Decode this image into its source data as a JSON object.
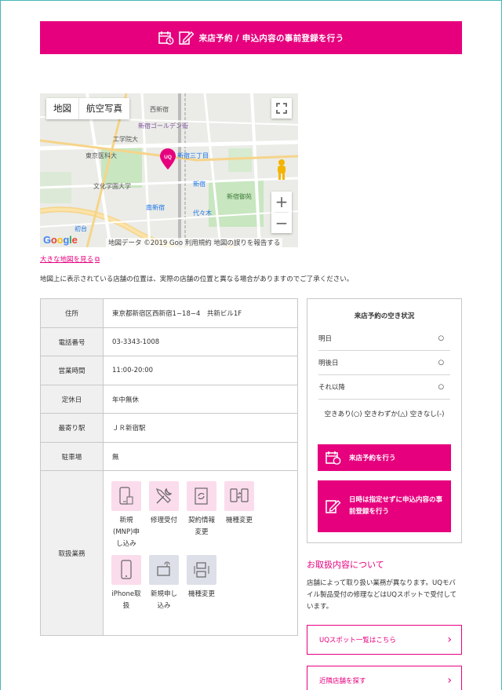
{
  "colors": {
    "accent": "#e6007e",
    "frame": "#48b6b9"
  },
  "top_button": {
    "label": "来店予約 / 申込内容の事前登録を行う",
    "icons": [
      "calendar-clock-icon",
      "pencil-note-icon"
    ]
  },
  "map": {
    "tabs": [
      "地図",
      "航空写真"
    ],
    "labels": {
      "west_shinjuku": "西新宿",
      "golden_gai": "新宿ゴールデン街",
      "kogakuin": "工学院大",
      "tokyo_medical": "東京医科大",
      "shinjuku_3": "新宿三丁目",
      "shinjuku_station": "新宿",
      "bunka": "文化学園大学",
      "shinjuku_gyoen": "新宿御苑",
      "minami_shinjuku": "南新宿",
      "yoyogi": "代々木",
      "hatsudai": "初台",
      "uq": "UQ"
    },
    "google": "Google",
    "copyright": "地図データ ©2019 Goo  利用規約  地図の誤りを報告する",
    "big_map_link": "大きな地図を見る",
    "notice": "地図上に表示されている店舗の位置は、実際の店舗の位置と異なる場合がありますのでご了承ください。"
  },
  "info": {
    "rows": [
      {
        "key": "住所",
        "value": "東京都新宿区西新宿1−18−4　共新ビル1F"
      },
      {
        "key": "電話番号",
        "value": "03-3343-1008"
      },
      {
        "key": "営業時間",
        "value": "11:00-20:00"
      },
      {
        "key": "定休日",
        "value": "年中無休"
      },
      {
        "key": "最寄り駅",
        "value": "ＪＲ新宿駅"
      },
      {
        "key": "駐車場",
        "value": "無"
      }
    ],
    "services_key": "取扱業務",
    "services": [
      {
        "label": "新規(MNP)申し込み",
        "icon": "phone-sim-icon",
        "tone": "pink"
      },
      {
        "label": "修理受付",
        "icon": "tools-icon",
        "tone": "pink"
      },
      {
        "label": "契約情報変更",
        "icon": "contract-refresh-icon",
        "tone": "pink"
      },
      {
        "label": "機種変更",
        "icon": "phone-swap-icon",
        "tone": "pink"
      },
      {
        "label": "iPhone取扱",
        "icon": "iphone-icon",
        "tone": "pink"
      },
      {
        "label": "新規申し込み",
        "icon": "router-icon",
        "tone": "gray"
      },
      {
        "label": "機種変更",
        "icon": "router-swap-icon",
        "tone": "gray"
      }
    ]
  },
  "side": {
    "title": "来店予約の空き状況",
    "availability": [
      {
        "day": "明日",
        "mark": "○"
      },
      {
        "day": "明後日",
        "mark": "○"
      },
      {
        "day": "それ以降",
        "mark": "○"
      }
    ],
    "legend": "空きあり(○) 空きわずか(△) 空きなし(-)",
    "reserve_button": "来店予約を行う",
    "preregister_button": "日時は指定せずに申込内容の事前登録を行う"
  },
  "about": {
    "title": "お取扱内容について",
    "text": "店舗によって取り扱い業務が異なります。UQモバイル製品受付の修理などはUQスポットで受付しています。",
    "links": [
      "UQスポット一覧はこちら",
      "近隣店舗を探す"
    ]
  }
}
